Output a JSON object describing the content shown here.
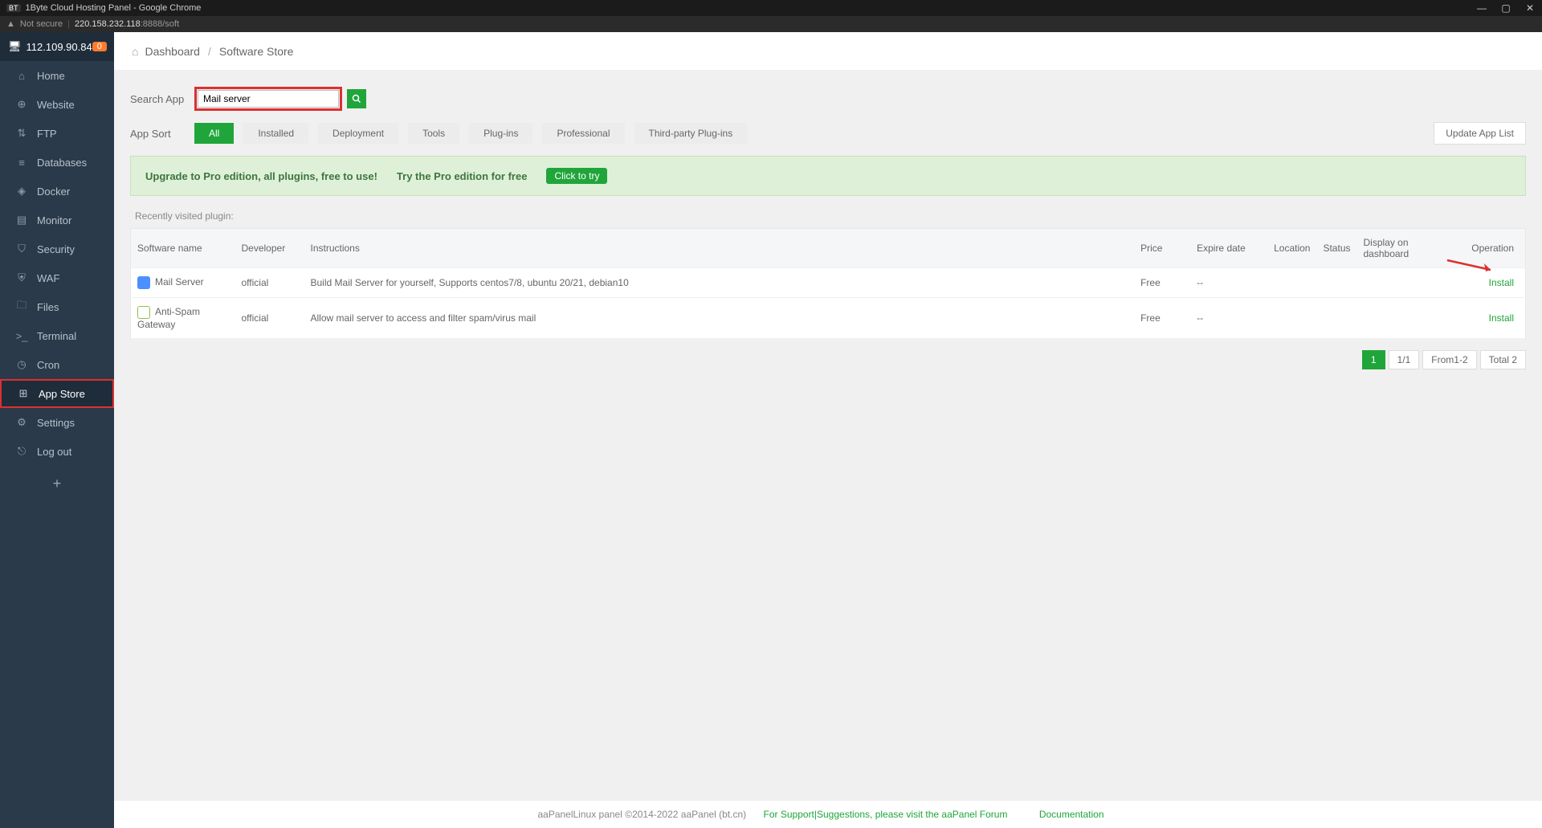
{
  "window": {
    "title": "1Byte Cloud Hosting Panel - Google Chrome",
    "bt_prefix": "BT"
  },
  "urlbar": {
    "not_secure": "Not secure",
    "host": "220.158.232.118",
    "port_path": ":8888/soft"
  },
  "sidebar": {
    "ip": "112.109.90.84",
    "badge": "0",
    "items": [
      {
        "label": "Home",
        "icon": "⌂"
      },
      {
        "label": "Website",
        "icon": "⊕"
      },
      {
        "label": "FTP",
        "icon": "⇅"
      },
      {
        "label": "Databases",
        "icon": "≡"
      },
      {
        "label": "Docker",
        "icon": "◈"
      },
      {
        "label": "Monitor",
        "icon": "▤"
      },
      {
        "label": "Security",
        "icon": "⛉"
      },
      {
        "label": "WAF",
        "icon": "⛨"
      },
      {
        "label": "Files",
        "icon": "🗀"
      },
      {
        "label": "Terminal",
        "icon": ">_"
      },
      {
        "label": "Cron",
        "icon": "◷"
      },
      {
        "label": "App Store",
        "icon": "⊞"
      },
      {
        "label": "Settings",
        "icon": "⚙"
      },
      {
        "label": "Log out",
        "icon": "⎋"
      }
    ]
  },
  "breadcrumb": {
    "home": "Dashboard",
    "current": "Software Store"
  },
  "search": {
    "label": "Search App",
    "value": "Mail server"
  },
  "sort": {
    "label": "App Sort",
    "tabs": [
      "All",
      "Installed",
      "Deployment",
      "Tools",
      "Plug-ins",
      "Professional",
      "Third-party Plug-ins"
    ],
    "update_btn": "Update App List"
  },
  "promo": {
    "upgrade": "Upgrade to Pro edition, all plugins, free to use!",
    "try": "Try the Pro edition for free",
    "click": "Click to try"
  },
  "recent_label": "Recently visited plugin:",
  "table": {
    "headers": {
      "name": "Software name",
      "dev": "Developer",
      "instr": "Instructions",
      "price": "Price",
      "expire": "Expire date",
      "location": "Location",
      "status": "Status",
      "display": "Display on dashboard",
      "op": "Operation"
    },
    "rows": [
      {
        "icon_class": "mail",
        "name": "Mail Server",
        "dev": "official",
        "instr": "Build Mail Server for yourself, Supports centos7/8, ubuntu 20/21, debian10",
        "price": "Free",
        "expire": "--",
        "op": "Install"
      },
      {
        "icon_class": "spam",
        "name": "Anti-Spam Gateway",
        "dev": "official",
        "instr": "Allow mail server to access and filter spam/virus mail",
        "price": "Free",
        "expire": "--",
        "op": "Install"
      }
    ]
  },
  "pagination": {
    "page": "1",
    "of": "1/1",
    "range": "From1-2",
    "total": "Total 2"
  },
  "footer": {
    "copyright": "aaPanelLinux panel ©2014-2022 aaPanel (bt.cn)",
    "support": "For Support|Suggestions, please visit the aaPanel Forum",
    "docs": "Documentation"
  }
}
